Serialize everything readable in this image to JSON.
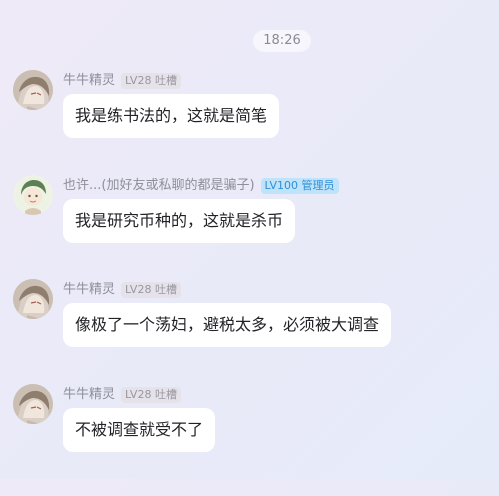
{
  "time": "18:26",
  "messages": [
    {
      "name": "牛牛精灵",
      "level": "LV28",
      "title": "吐槽",
      "badge_color": "#9a97a2",
      "text": "我是练书法的，这就是简笔",
      "avatar_icon": "anime-girl-avatar-icon"
    },
    {
      "name": "也许...(加好友或私聊的都是骗子)",
      "level": "LV100",
      "title": "管理员",
      "badge_color": "#2f8fd8",
      "text": "我是研究币种的，这就是杀币",
      "avatar_icon": "anime-boy-avatar-icon"
    },
    {
      "name": "牛牛精灵",
      "level": "LV28",
      "title": "吐槽",
      "badge_color": "#9a97a2",
      "text": "像极了一个荡妇，避税太多，必须被大调查",
      "avatar_icon": "anime-girl-avatar-icon"
    },
    {
      "name": "牛牛精灵",
      "level": "LV28",
      "title": "吐槽",
      "badge_color": "#9a97a2",
      "text": "不被调查就受不了",
      "avatar_icon": "anime-girl-avatar-icon"
    }
  ]
}
